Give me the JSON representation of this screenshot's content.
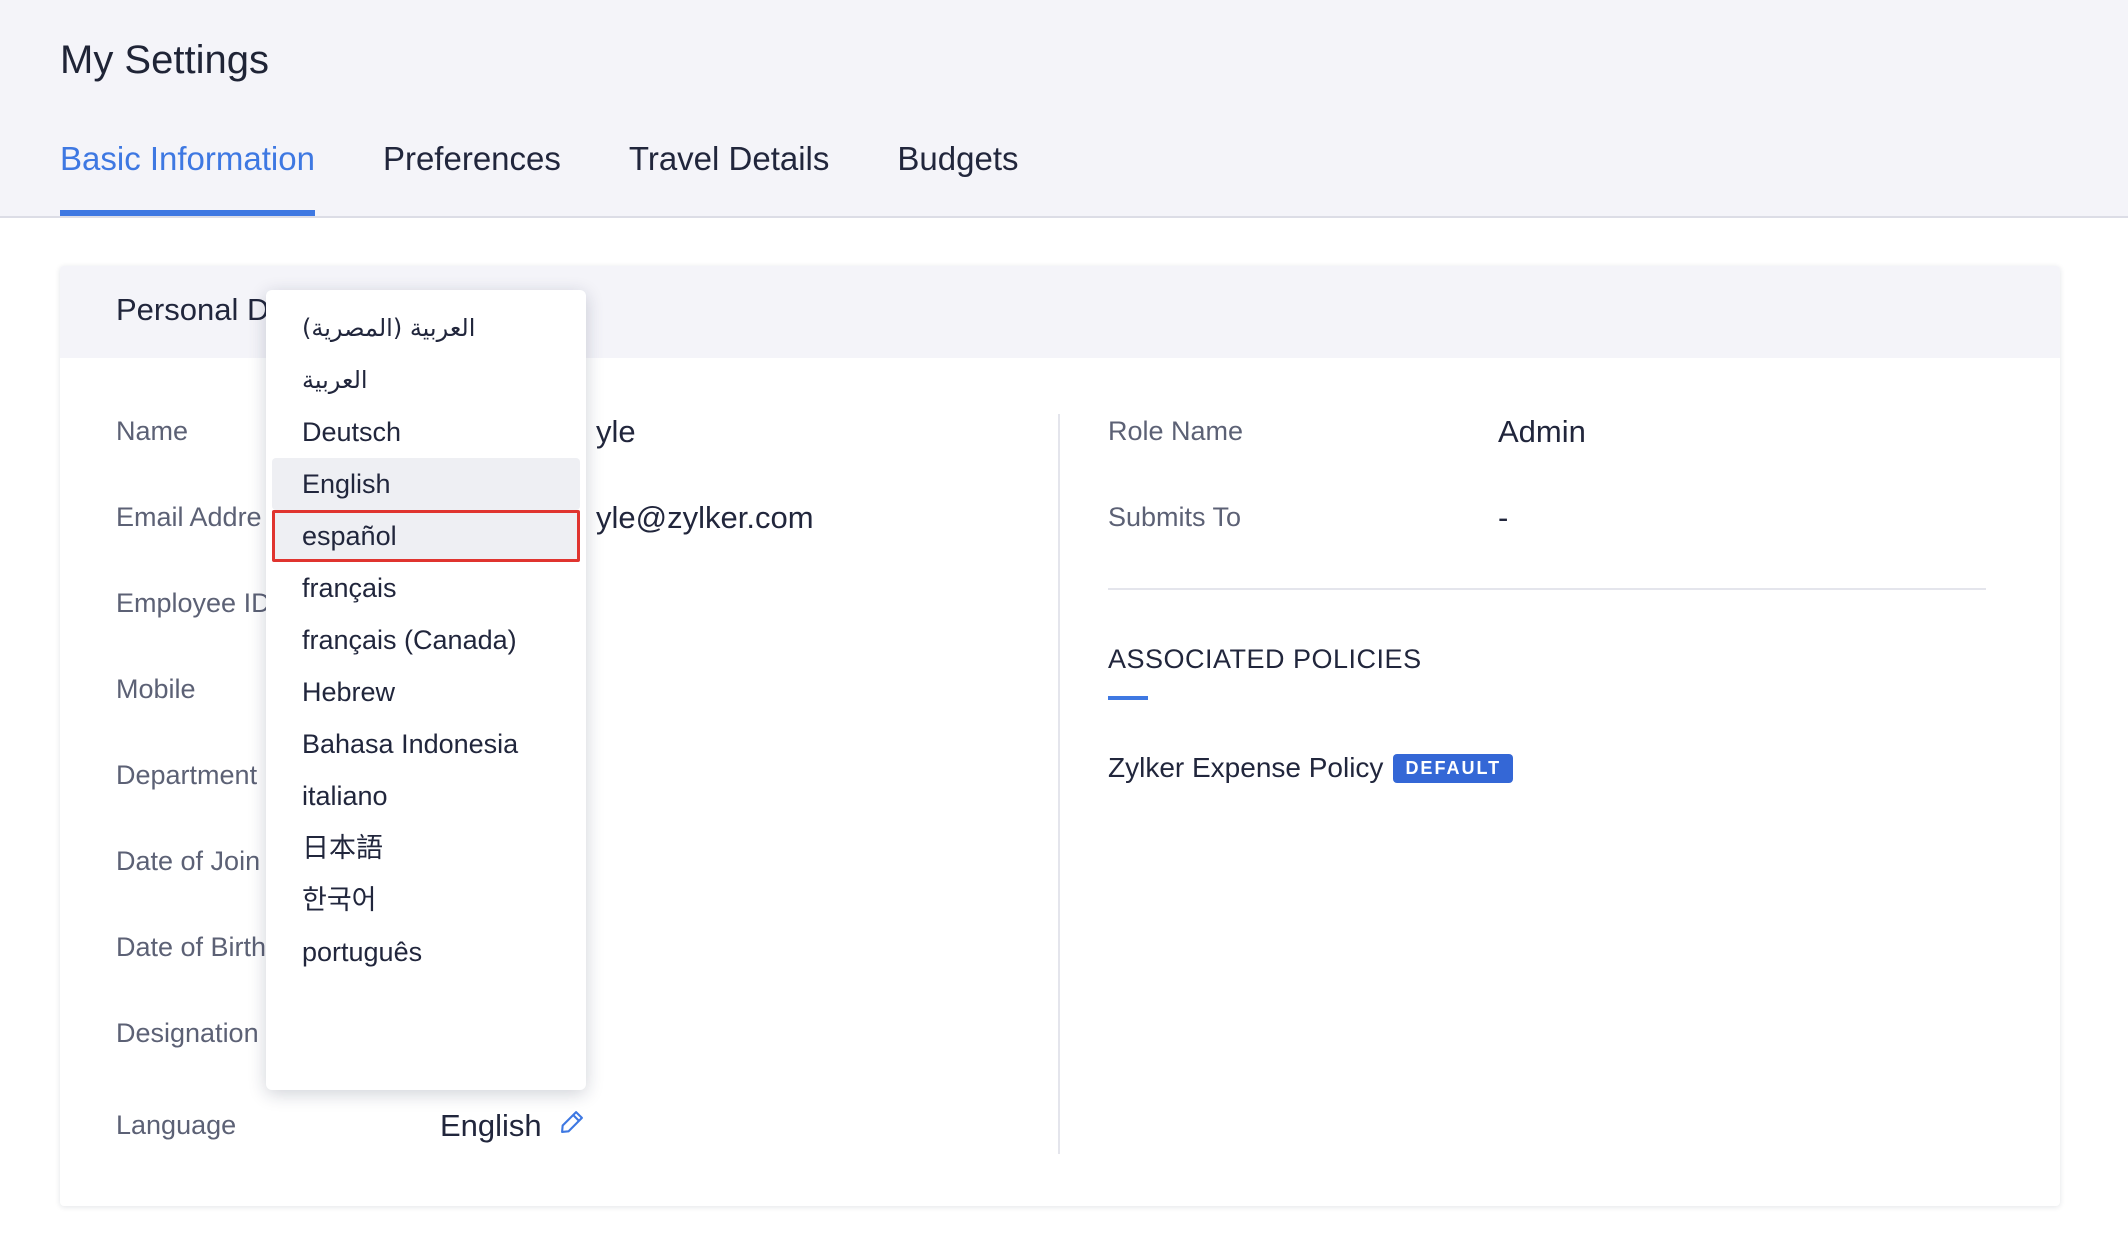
{
  "page": {
    "title": "My Settings"
  },
  "tabs": [
    {
      "label": "Basic Information",
      "active": true
    },
    {
      "label": "Preferences",
      "active": false
    },
    {
      "label": "Travel Details",
      "active": false
    },
    {
      "label": "Budgets",
      "active": false
    }
  ],
  "card": {
    "title": "Personal Details",
    "title_visible": "Personal D",
    "fields": [
      {
        "label": "Name",
        "label_visible": "Name",
        "value_visible": "yle"
      },
      {
        "label": "Email Address",
        "label_visible": "Email Addre",
        "value_visible": "yle@zylker.com"
      },
      {
        "label": "Employee ID",
        "label_visible": "Employee ID",
        "value_visible": ""
      },
      {
        "label": "Mobile",
        "label_visible": "Mobile",
        "value_visible": ""
      },
      {
        "label": "Department",
        "label_visible": "Department",
        "value_visible": ""
      },
      {
        "label": "Date of Joining",
        "label_visible": "Date of Join",
        "value_visible": ""
      },
      {
        "label": "Date of Birth",
        "label_visible": "Date of Birth",
        "value_visible": ""
      },
      {
        "label": "Designation",
        "label_visible": "Designation",
        "value_visible": ""
      },
      {
        "label": "Language",
        "label_visible": "Language",
        "value_visible": "English"
      }
    ],
    "edit_icon": "pencil-icon",
    "right": {
      "role_label": "Role Name",
      "role_value": "Admin",
      "submits_label": "Submits To",
      "submits_value": "-",
      "policies_heading": "ASSOCIATED POLICIES",
      "policy_name": "Zylker Expense Policy",
      "policy_badge": "DEFAULT"
    }
  },
  "language_dropdown": {
    "selected": "English",
    "highlighted": "español",
    "options": [
      "العربية (المصرية)",
      "العربية",
      "Deutsch",
      "English",
      "español",
      "français",
      "français (Canada)",
      "Hebrew",
      "Bahasa Indonesia",
      "italiano",
      "日本語",
      "한국어",
      "português"
    ]
  },
  "colors": {
    "accent": "#3e78e2",
    "badge": "#3467d6",
    "highlight_border": "#e0342f",
    "header_bg": "#f4f4f9"
  }
}
